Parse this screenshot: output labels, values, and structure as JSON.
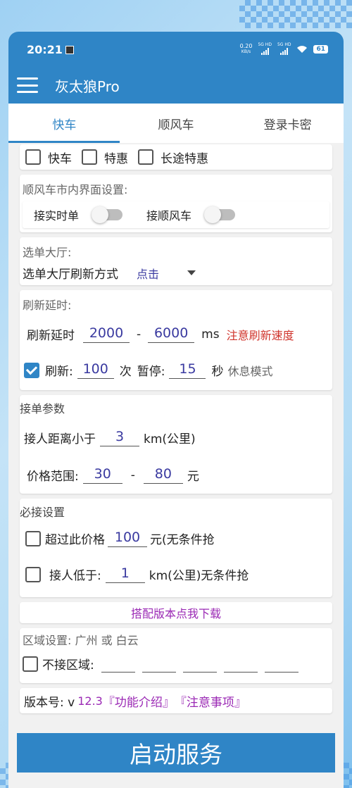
{
  "status_bar": {
    "time": "20:21",
    "speed": "0.20",
    "speed_unit": "KB/s",
    "sim1": "5G HD",
    "sim2": "5G HD",
    "battery": "61"
  },
  "app": {
    "title": "灰太狼Pro"
  },
  "tabs": [
    {
      "label": "快车",
      "active": true
    },
    {
      "label": "顺风车",
      "active": false
    },
    {
      "label": "登录卡密",
      "active": false
    }
  ],
  "car_types": {
    "options": [
      {
        "label": "快车",
        "checked": false
      },
      {
        "label": "特惠",
        "checked": false
      },
      {
        "label": "长途特惠",
        "checked": false
      }
    ]
  },
  "ride_share": {
    "heading": "顺风车市内界面设置:",
    "realtime_label": "接实时单",
    "realtime_on": false,
    "rideshare_label": "接顺风车",
    "rideshare_on": false
  },
  "hall": {
    "heading": "选单大厅:",
    "refresh_mode_label": "选单大厅刷新方式",
    "refresh_mode_value": "点击"
  },
  "refresh_delay": {
    "heading": "刷新延时:",
    "label": "刷新延时",
    "min": "2000",
    "dash": "-",
    "max": "6000",
    "unit": "ms",
    "warning": "注意刷新速度",
    "refresh_checked": true,
    "refresh_label": "刷新:",
    "refresh_count": "100",
    "times_label": "次",
    "pause_label": "暂停:",
    "pause_seconds": "15",
    "seconds_label": "秒",
    "rest_mode": "休息模式"
  },
  "order_params": {
    "heading": "接单参数",
    "distance_label": "接人距离小于",
    "distance_value": "3",
    "distance_unit": "km(公里)",
    "price_label": "价格范围:",
    "price_min": "30",
    "dash": "-",
    "price_max": "80",
    "price_unit": "元"
  },
  "must_accept": {
    "heading": "必接设置",
    "over_price_label": "超过此价格",
    "over_price_value": "100",
    "over_price_suffix": "元(无条件抢",
    "over_price_checked": false,
    "pickup_label": "接人低于:",
    "pickup_value": "1",
    "pickup_suffix": "km(公里)无条件抢",
    "pickup_checked": false
  },
  "download_link": "搭配版本点我下载",
  "region": {
    "heading": "区域设置: 广州 或 白云",
    "exclude_label": "不接区域:",
    "exclude_checked": false,
    "fields": [
      "",
      "",
      "",
      "",
      ""
    ]
  },
  "version": {
    "label": "版本号: v",
    "number": "12.3",
    "features": "『功能介绍』",
    "notes": "『注意事项』"
  },
  "start_button": "启动服务"
}
